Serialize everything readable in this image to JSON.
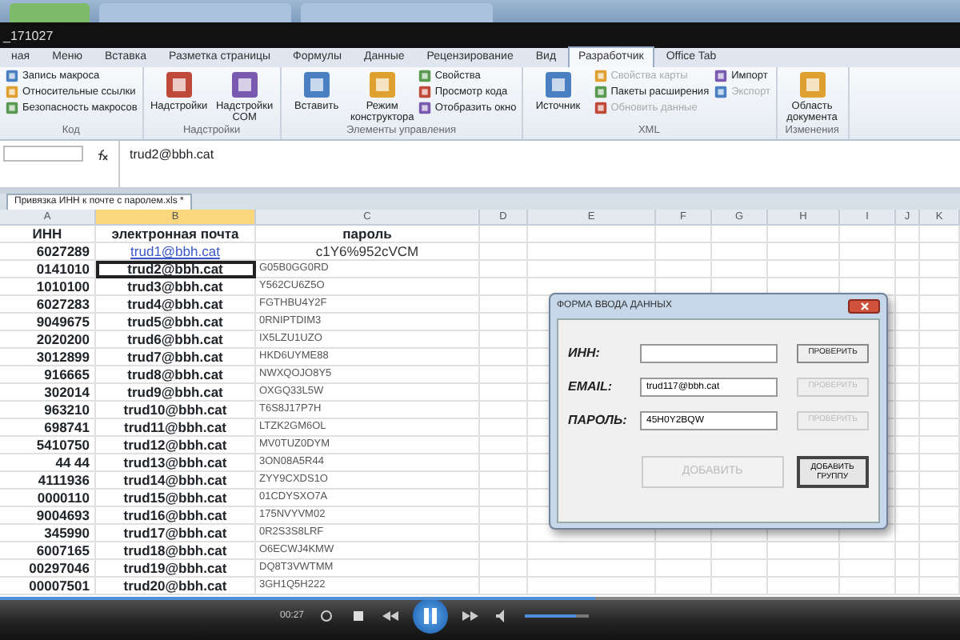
{
  "browser_tabs": [
    {
      "selected": true
    },
    {
      "selected": false
    },
    {
      "selected": false
    }
  ],
  "window": {
    "title": "_171027"
  },
  "ribbon": {
    "tabs": [
      {
        "label": "ная",
        "selected": false
      },
      {
        "label": "Меню",
        "selected": false
      },
      {
        "label": "Вставка",
        "selected": false
      },
      {
        "label": "Разметка страницы",
        "selected": false
      },
      {
        "label": "Формулы",
        "selected": false
      },
      {
        "label": "Данные",
        "selected": false
      },
      {
        "label": "Рецензирование",
        "selected": false
      },
      {
        "label": "Вид",
        "selected": false
      },
      {
        "label": "Разработчик",
        "selected": true
      },
      {
        "label": "Office Tab",
        "selected": false
      }
    ],
    "groups": [
      {
        "label": "Код",
        "items": [
          {
            "label": "Запись макроса",
            "kind": "small",
            "disabled": false
          },
          {
            "label": "Относительные ссылки",
            "kind": "small",
            "disabled": false
          },
          {
            "label": "Безопасность макросов",
            "kind": "small",
            "disabled": false
          }
        ]
      },
      {
        "label": "Надстройки",
        "items": [
          {
            "label": "Надстройки",
            "kind": "large",
            "disabled": false
          },
          {
            "label": "Надстройки COM",
            "kind": "large",
            "disabled": false
          }
        ]
      },
      {
        "label": "Элементы управления",
        "items": [
          {
            "label": "Вставить",
            "kind": "large",
            "disabled": false
          },
          {
            "label": "Режим конструктора",
            "kind": "large",
            "disabled": false
          },
          {
            "label": "Свойства",
            "kind": "small",
            "disabled": false
          },
          {
            "label": "Просмотр кода",
            "kind": "small",
            "disabled": false
          },
          {
            "label": "Отобразить окно",
            "kind": "small",
            "disabled": false
          }
        ]
      },
      {
        "label": "XML",
        "items": [
          {
            "label": "Источник",
            "kind": "large",
            "disabled": false
          },
          {
            "label": "Свойства карты",
            "kind": "small",
            "disabled": true
          },
          {
            "label": "Пакеты расширения",
            "kind": "small",
            "disabled": false
          },
          {
            "label": "Обновить данные",
            "kind": "small",
            "disabled": true
          },
          {
            "label": "Импорт",
            "kind": "small",
            "disabled": false
          },
          {
            "label": "Экспорт",
            "kind": "small",
            "disabled": true
          }
        ]
      },
      {
        "label": "Изменения",
        "items": [
          {
            "label": "Область документа",
            "kind": "large",
            "disabled": false
          }
        ]
      }
    ]
  },
  "formula_bar": {
    "value": "trud2@bbh.cat"
  },
  "workbook_tab": {
    "label": "Привязка ИНН к почте с паролем.xls *"
  },
  "sheet": {
    "columns": [
      {
        "label": "A",
        "selected": false
      },
      {
        "label": "B",
        "selected": true
      },
      {
        "label": "C",
        "selected": false
      },
      {
        "label": "D",
        "selected": false
      },
      {
        "label": "E",
        "selected": false
      },
      {
        "label": "F",
        "selected": false
      },
      {
        "label": "G",
        "selected": false
      },
      {
        "label": "H",
        "selected": false
      },
      {
        "label": "I",
        "selected": false
      },
      {
        "label": "J",
        "selected": false
      },
      {
        "label": "K",
        "selected": false
      }
    ],
    "header": [
      "ИНН",
      "электронная почта",
      "пароль"
    ],
    "rows": [
      {
        "kind": "link",
        "inn": "6027289",
        "email": "trud1@bbh.cat",
        "password": "c1Y6%952cVCM",
        "selected": false
      },
      {
        "kind": "plain",
        "inn": "0141010",
        "email": "trud2@bbh.cat",
        "password": "G05B0GG0RD",
        "selected": true
      },
      {
        "kind": "plain",
        "inn": "1010100",
        "email": "trud3@bbh.cat",
        "password": "Y562CU6Z5O",
        "selected": false
      },
      {
        "kind": "plain",
        "inn": "6027283",
        "email": "trud4@bbh.cat",
        "password": "FGTHBU4Y2F",
        "selected": false
      },
      {
        "kind": "plain",
        "inn": "9049675",
        "email": "trud5@bbh.cat",
        "password": "0RNIPTDIM3",
        "selected": false
      },
      {
        "kind": "plain",
        "inn": "2020200",
        "email": "trud6@bbh.cat",
        "password": "IX5LZU1UZO",
        "selected": false
      },
      {
        "kind": "plain",
        "inn": "3012899",
        "email": "trud7@bbh.cat",
        "password": "HKD6UYME88",
        "selected": false
      },
      {
        "kind": "plain",
        "inn": "916665",
        "email": "trud8@bbh.cat",
        "password": "NWXQOJO8Y5",
        "selected": false
      },
      {
        "kind": "plain",
        "inn": "302014",
        "email": "trud9@bbh.cat",
        "password": "OXGQ33L5W",
        "selected": false
      },
      {
        "kind": "plain",
        "inn": "963210",
        "email": "trud10@bbh.cat",
        "password": "T6S8J17P7H",
        "selected": false
      },
      {
        "kind": "plain",
        "inn": "698741",
        "email": "trud11@bbh.cat",
        "password": "LTZK2GM6OL",
        "selected": false
      },
      {
        "kind": "plain",
        "inn": "5410750",
        "email": "trud12@bbh.cat",
        "password": "MV0TUZ0DYM",
        "selected": false
      },
      {
        "kind": "plain",
        "inn": "44 44",
        "email": "trud13@bbh.cat",
        "password": "3ON08A5R44",
        "selected": false
      },
      {
        "kind": "plain",
        "inn": "4111936",
        "email": "trud14@bbh.cat",
        "password": "ZYY9CXDS1O",
        "selected": false
      },
      {
        "kind": "plain",
        "inn": "0000110",
        "email": "trud15@bbh.cat",
        "password": "01CDYSXO7A",
        "selected": false
      },
      {
        "kind": "plain",
        "inn": "9004693",
        "email": "trud16@bbh.cat",
        "password": "175NVYVM02",
        "selected": false
      },
      {
        "kind": "plain",
        "inn": "345990",
        "email": "trud17@bbh.cat",
        "password": "0R2S3S8LRF",
        "selected": false
      },
      {
        "kind": "plain",
        "inn": "6007165",
        "email": "trud18@bbh.cat",
        "password": "O6ECWJ4KMW",
        "selected": false
      },
      {
        "kind": "plain",
        "inn": "00297046",
        "email": "trud19@bbh.cat",
        "password": "DQ8T3VWTMM",
        "selected": false
      },
      {
        "kind": "plain",
        "inn": "00007501",
        "email": "trud20@bbh.cat",
        "password": "3GH1Q5H222",
        "selected": false
      }
    ]
  },
  "dialog": {
    "title": "ФОРМА ВВОДА ДАННЫХ",
    "fields": [
      {
        "label": "ИНН:",
        "button": {
          "label": "ПРОВЕРИТЬ",
          "disabled": false
        }
      },
      {
        "label": "EMAIL:",
        "value": "trud117@bbh.cat",
        "button": {
          "label": "ПРОВЕРИТЬ",
          "disabled": true
        }
      },
      {
        "label": "ПАРОЛЬ:",
        "value": "45H0Y2BQW",
        "button": {
          "label": "ПРОВЕРИТЬ",
          "disabled": true
        }
      }
    ],
    "buttons": [
      {
        "label": "ДОБАВИТЬ",
        "disabled": true
      },
      {
        "label": "ДОБАВИТЬ ГРУППУ",
        "disabled": false
      }
    ]
  },
  "player": {
    "time": "00:27",
    "seek": {
      "level": 0.62
    },
    "volume": {
      "level": 0.8
    }
  }
}
